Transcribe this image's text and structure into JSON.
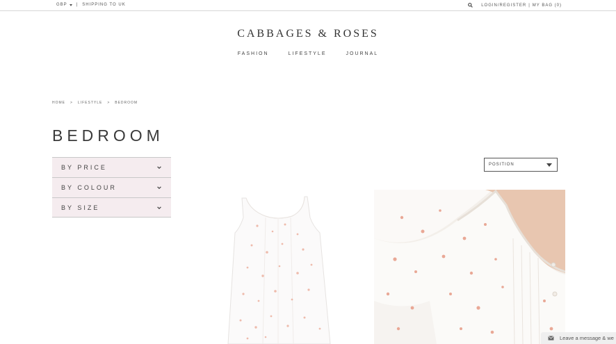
{
  "topbar": {
    "currency": "GBP",
    "shipping": "SHIPPING TO UK",
    "separator": "|",
    "login": "LOGIN/REGISTER",
    "bag": "MY BAG (0)",
    "icons": {
      "currency_caret": "caret-down-icon",
      "search": "search-icon"
    }
  },
  "brand": {
    "logo": "CABBAGES & ROSES"
  },
  "nav": {
    "items": [
      "FASHION",
      "LIFESTYLE",
      "JOURNAL"
    ]
  },
  "breadcrumb": {
    "items": [
      "HOME",
      "LIFESTYLE",
      "BEDROOM"
    ],
    "separator": ">"
  },
  "page": {
    "title": "BEDROOM"
  },
  "filters": {
    "items": [
      "BY PRICE",
      "BY COLOUR",
      "BY SIZE"
    ],
    "icon": "chevron-down-icon"
  },
  "sort": {
    "selected": "POSITION"
  },
  "products": [
    {
      "image": "white-floral-nightdress"
    },
    {
      "image": "white-floral-blouse-closeup"
    }
  ],
  "chat": {
    "label": "Leave a message & we",
    "icon": "mail-icon"
  },
  "colors": {
    "filter_bg": "#f5ecef",
    "text": "#3a3a3a",
    "border": "#c8c8c8",
    "floral": "#e8a58f"
  }
}
